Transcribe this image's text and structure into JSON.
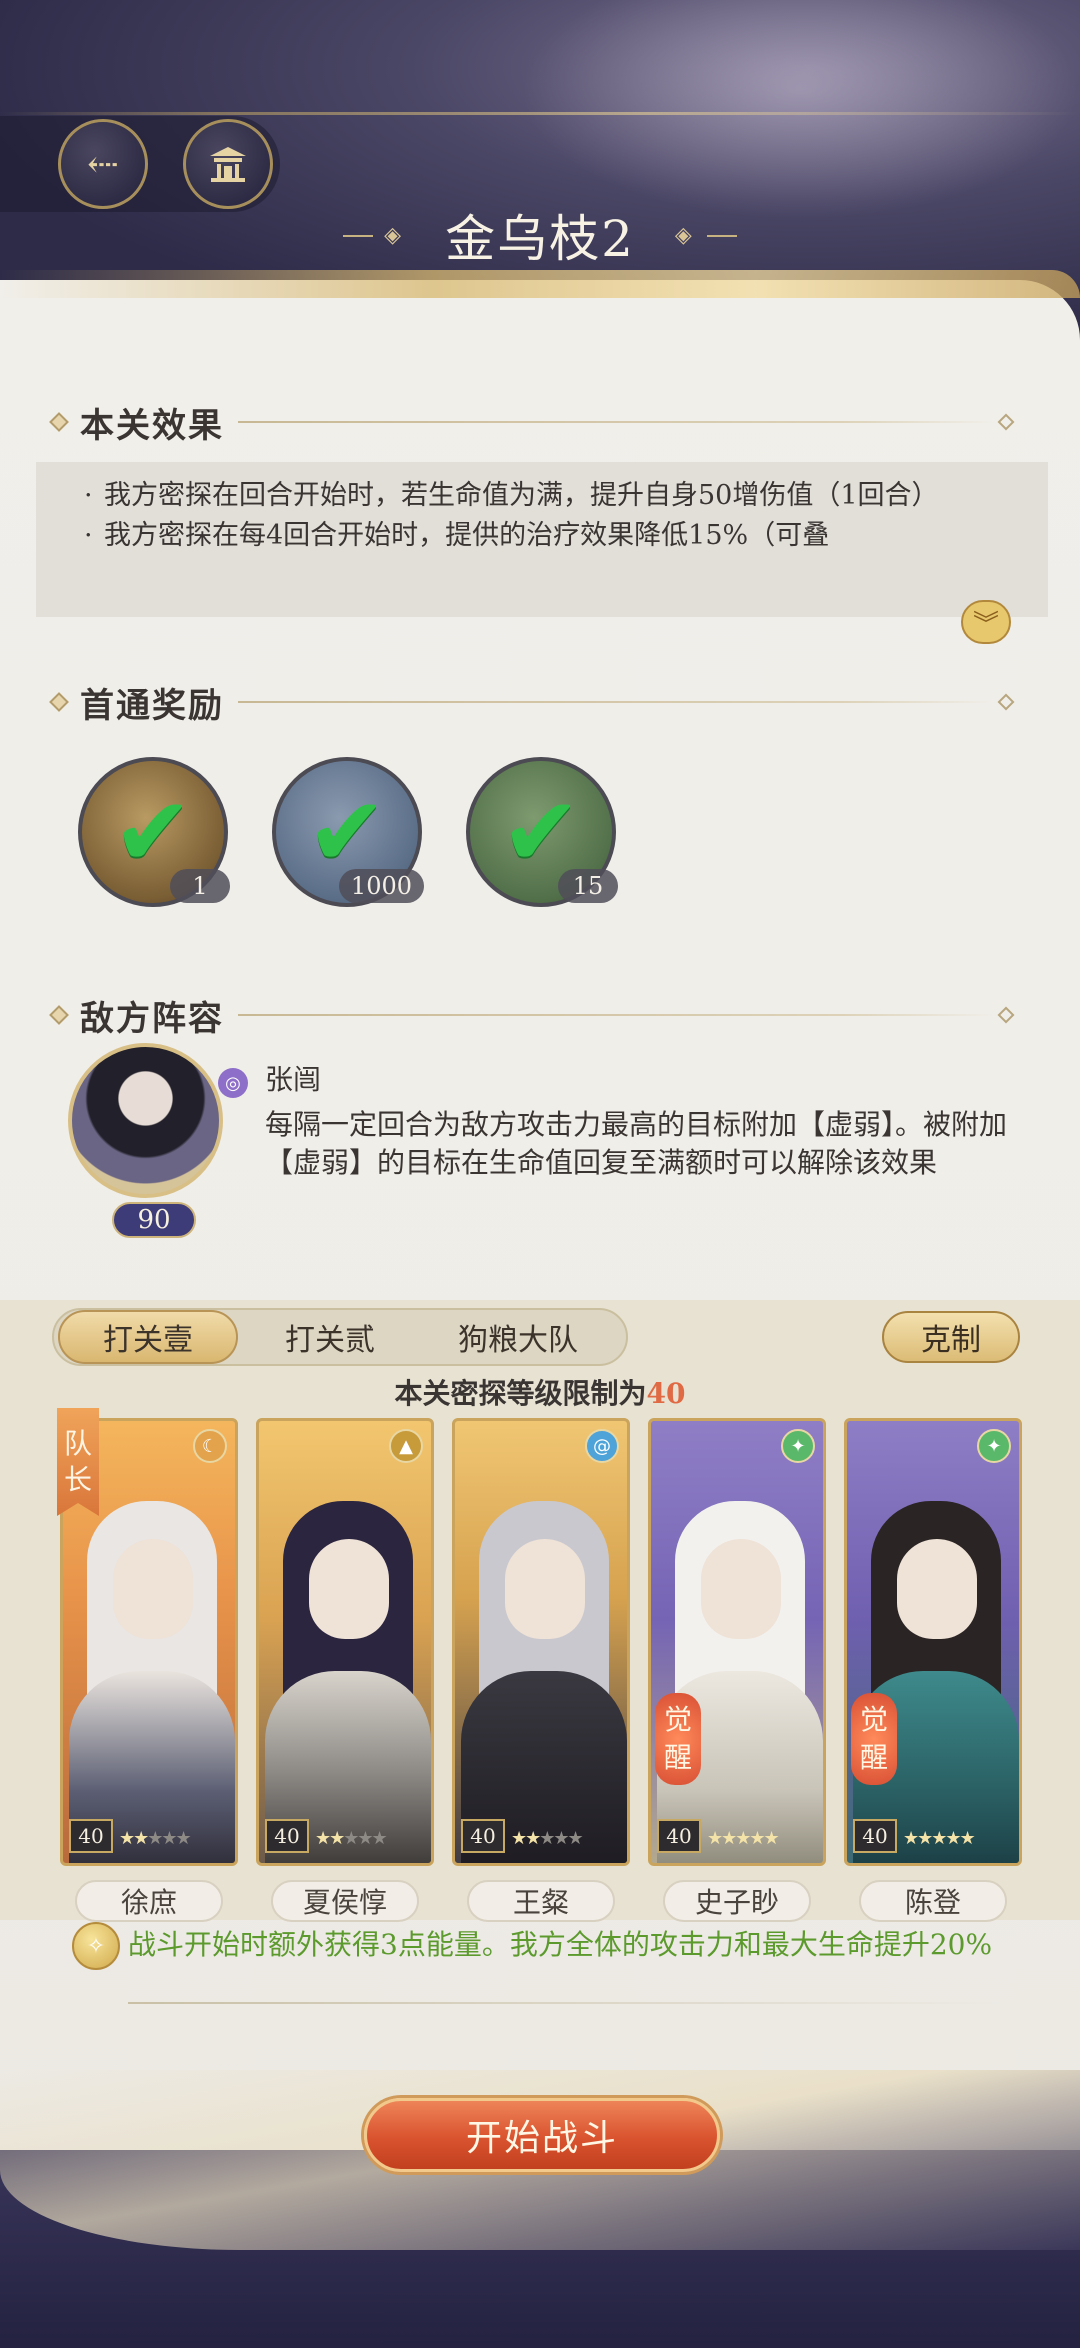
{
  "header": {
    "title": "金乌枝2"
  },
  "effects": {
    "heading": "本关效果",
    "items": [
      "我方密探在回合开始时，若生命值为满，提升自身50增伤值（1回合）",
      "我方密探在每4回合开始时，提供的治疗效果降低15%（可叠"
    ]
  },
  "rewards": {
    "heading": "首通奖励",
    "items": [
      {
        "count": "1"
      },
      {
        "count": "1000"
      },
      {
        "count": "15"
      }
    ]
  },
  "enemy": {
    "heading": "敌方阵容",
    "name": "张闿",
    "level": "90",
    "description": "每隔一定回合为敌方攻击力最高的目标附加【虚弱】。被附加【虚弱】的目标在生命值回复至满额时可以解除该效果"
  },
  "team": {
    "tabs": [
      "打关壹",
      "打关贰",
      "狗粮大队"
    ],
    "counter_label": "克制",
    "level_limit_prefix": "本关密探等级限制为",
    "level_limit_value": "40",
    "leader_label": "队长",
    "awaken_label": "觉醒",
    "heroes": [
      {
        "name": "徐庶",
        "level": "40",
        "stars_filled": 2,
        "element": "moon-icon"
      },
      {
        "name": "夏侯惇",
        "level": "40",
        "stars_filled": 2,
        "element": "mountain-icon"
      },
      {
        "name": "王粲",
        "level": "40",
        "stars_filled": 2,
        "element": "swirl-icon"
      },
      {
        "name": "史子眇",
        "level": "40",
        "stars_filled": 5,
        "element": "wind-icon",
        "awakened": true
      },
      {
        "name": "陈登",
        "level": "40",
        "stars_filled": 5,
        "element": "wind-icon",
        "awakened": true
      }
    ],
    "bonus_text": "战斗开始时额外获得3点能量。我方全体的攻击力和最大生命提升20%"
  },
  "start_button": "开始战斗",
  "colors": {
    "accent_gold": "#caa45c",
    "success_green": "#2fc24a",
    "highlight_orange": "#e06a44",
    "bonus_green": "#5c9a2e",
    "start_red": "#d9532f"
  }
}
